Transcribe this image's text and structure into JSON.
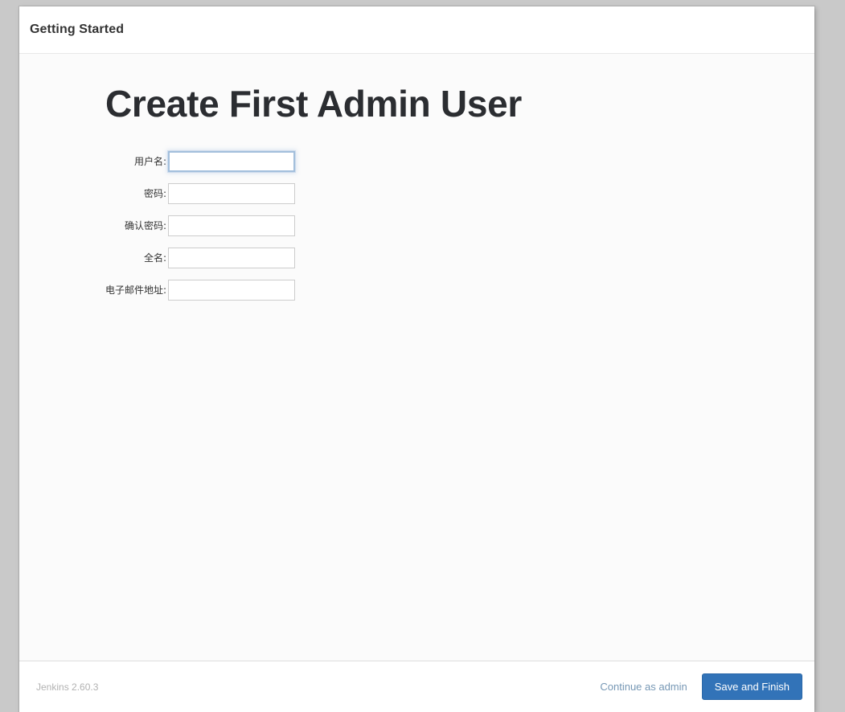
{
  "window": {
    "header_title": "Getting Started"
  },
  "main": {
    "title": "Create First Admin User",
    "form": {
      "fields": [
        {
          "name": "username",
          "label": "用户名:",
          "value": "",
          "placeholder": "",
          "type": "text",
          "focused": true
        },
        {
          "name": "password",
          "label": "密码:",
          "value": "",
          "placeholder": "",
          "type": "password",
          "focused": false
        },
        {
          "name": "confirm-password",
          "label": "确认密码:",
          "value": "",
          "placeholder": "",
          "type": "password",
          "focused": false
        },
        {
          "name": "fullname",
          "label": "全名:",
          "value": "",
          "placeholder": "",
          "type": "text",
          "focused": false
        },
        {
          "name": "email",
          "label": "电子邮件地址:",
          "value": "",
          "placeholder": "",
          "type": "text",
          "focused": false
        }
      ]
    }
  },
  "footer": {
    "version": "Jenkins 2.60.3",
    "continue_link": "Continue as admin",
    "save_button": "Save and Finish"
  },
  "colors": {
    "page_background": "#c9c9c9",
    "card_background": "#ffffff",
    "body_background": "#fbfbfb",
    "primary_button": "#3273b8",
    "link": "#7798b5",
    "title_text": "#2b2d31",
    "version_text": "#b2b2b2",
    "input_border": "#cccccc",
    "input_focus_border": "#a3bfdc"
  }
}
